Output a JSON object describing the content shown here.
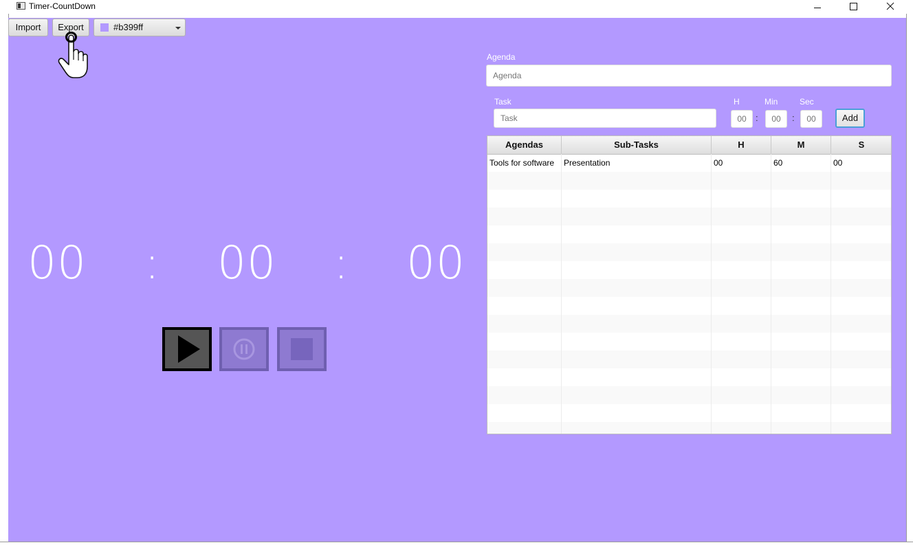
{
  "window": {
    "title": "Timer-CountDown",
    "minimize": "—",
    "maximize": "☐",
    "close": "✕"
  },
  "toolbar": {
    "import_label": "Import",
    "export_label": "Export",
    "color_value": "#b399ff"
  },
  "theme": {
    "background": "#b399ff"
  },
  "timer": {
    "hours": "00",
    "minutes": "00",
    "seconds": "00",
    "separator": ":"
  },
  "controls": {
    "play": "play-icon",
    "pause": "pause-icon",
    "stop": "stop-icon"
  },
  "form": {
    "agenda_label": "Agenda",
    "agenda_placeholder": "Agenda",
    "task_label": "Task",
    "task_placeholder": "Task",
    "h_label": "H",
    "min_label": "Min",
    "sec_label": "Sec",
    "h_placeholder": "00",
    "min_placeholder": "00",
    "sec_placeholder": "00",
    "sep": ":",
    "add_label": "Add"
  },
  "table": {
    "columns": [
      "Agendas",
      "Sub-Tasks",
      "H",
      "M",
      "S"
    ],
    "rows": [
      [
        "Tools for software",
        "Presentation",
        "00",
        "60",
        "00"
      ]
    ]
  }
}
